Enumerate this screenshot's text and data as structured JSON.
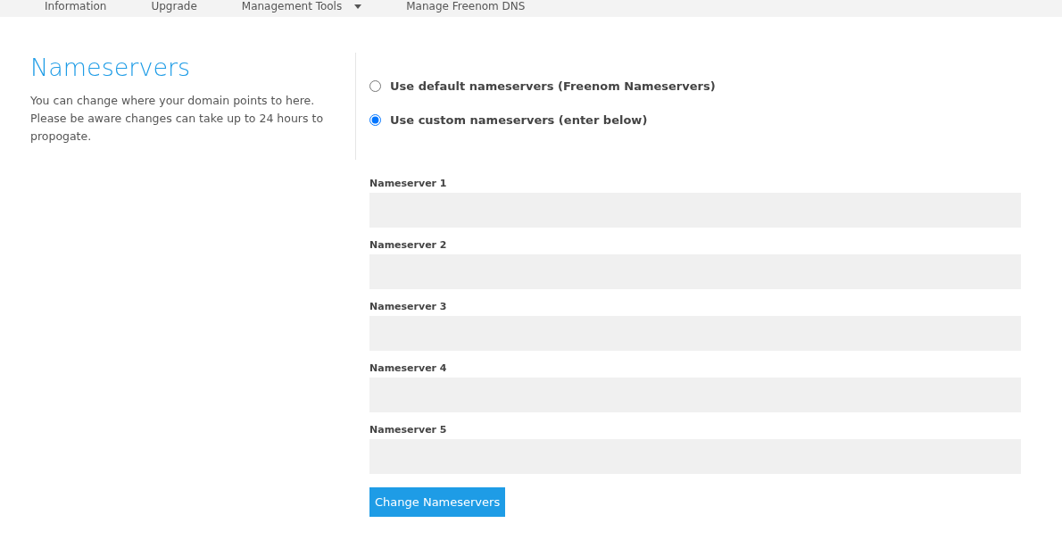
{
  "nav": [
    {
      "label": "Information",
      "dropdown": false
    },
    {
      "label": "Upgrade",
      "dropdown": false
    },
    {
      "label": "Management Tools",
      "dropdown": true
    },
    {
      "label": "Manage Freenom DNS",
      "dropdown": false
    }
  ],
  "heading": "Nameservers",
  "description": "You can change where your domain points to here. Please be aware changes can take up to 24 hours to propogate.",
  "options": [
    {
      "label": "Use default nameservers (Freenom Nameservers)",
      "selected": false
    },
    {
      "label": "Use custom nameservers (enter below)",
      "selected": true
    }
  ],
  "fields": [
    {
      "label": "Nameserver 1"
    },
    {
      "label": "Nameserver 2"
    },
    {
      "label": "Nameserver 3"
    },
    {
      "label": "Nameserver 4"
    },
    {
      "label": "Nameserver 5"
    }
  ],
  "submit": "Change Nameservers"
}
